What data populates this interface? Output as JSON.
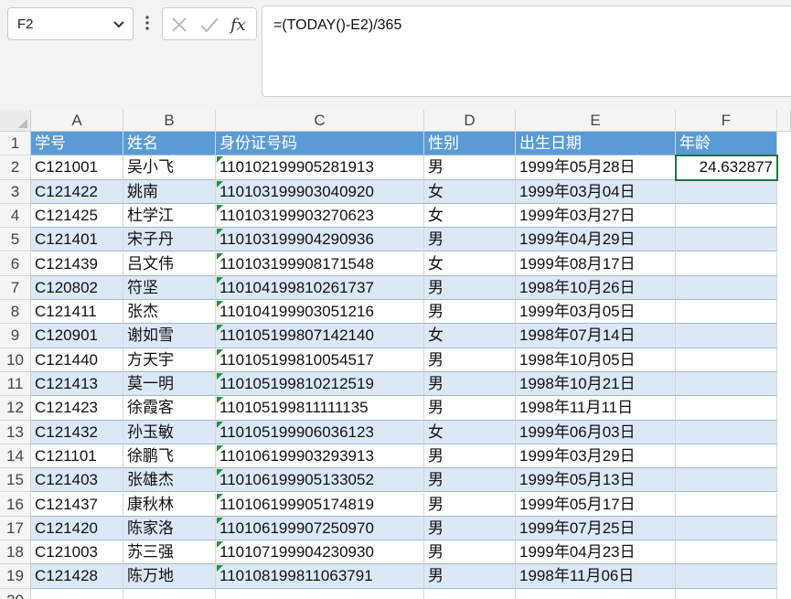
{
  "name_box": {
    "value": "F2"
  },
  "formula_bar": {
    "formula": "=(TODAY()-E2)/365"
  },
  "icons": {
    "dropdown": "chevron-down-icon",
    "more": "vertical-ellipsis-icon",
    "cancel": "cancel-x-icon",
    "enter": "checkmark-icon",
    "function": "fx-icon"
  },
  "colors": {
    "header_fill": "#5b9bd5",
    "band_fill": "#dde8f5",
    "error_flag": "#2e8b3a"
  },
  "column_headers": [
    "A",
    "B",
    "C",
    "D",
    "E",
    "F"
  ],
  "row_numbers": [
    "1",
    "2",
    "3",
    "4",
    "5",
    "6",
    "7",
    "8",
    "9",
    "10",
    "11",
    "12",
    "13",
    "14",
    "15",
    "16",
    "17",
    "18",
    "19",
    "20"
  ],
  "table": {
    "headers": [
      "学号",
      "姓名",
      "身份证号码",
      "性别",
      "出生日期",
      "年龄"
    ],
    "rows": [
      [
        "C121001",
        "吴小飞",
        "110102199905281913",
        "男",
        "1999年05月28日",
        "24.632877"
      ],
      [
        "C121422",
        "姚南",
        "110103199903040920",
        "女",
        "1999年03月04日",
        ""
      ],
      [
        "C121425",
        "杜学江",
        "110103199903270623",
        "女",
        "1999年03月27日",
        ""
      ],
      [
        "C121401",
        "宋子丹",
        "110103199904290936",
        "男",
        "1999年04月29日",
        ""
      ],
      [
        "C121439",
        "吕文伟",
        "110103199908171548",
        "女",
        "1999年08月17日",
        ""
      ],
      [
        "C120802",
        "符坚",
        "110104199810261737",
        "男",
        "1998年10月26日",
        ""
      ],
      [
        "C121411",
        "张杰",
        "110104199903051216",
        "男",
        "1999年03月05日",
        ""
      ],
      [
        "C120901",
        "谢如雪",
        "110105199807142140",
        "女",
        "1998年07月14日",
        ""
      ],
      [
        "C121440",
        "方天宇",
        "110105199810054517",
        "男",
        "1998年10月05日",
        ""
      ],
      [
        "C121413",
        "莫一明",
        "110105199810212519",
        "男",
        "1998年10月21日",
        ""
      ],
      [
        "C121423",
        "徐霞客",
        "110105199811111135",
        "男",
        "1998年11月11日",
        ""
      ],
      [
        "C121432",
        "孙玉敏",
        "110105199906036123",
        "女",
        "1999年06月03日",
        ""
      ],
      [
        "C121101",
        "徐鹏飞",
        "110106199903293913",
        "男",
        "1999年03月29日",
        ""
      ],
      [
        "C121403",
        "张雄杰",
        "110106199905133052",
        "男",
        "1999年05月13日",
        ""
      ],
      [
        "C121437",
        "康秋林",
        "110106199905174819",
        "男",
        "1999年05月17日",
        ""
      ],
      [
        "C121420",
        "陈家洛",
        "110106199907250970",
        "男",
        "1999年07月25日",
        ""
      ],
      [
        "C121003",
        "苏三强",
        "110107199904230930",
        "男",
        "1999年04月23日",
        ""
      ],
      [
        "C121428",
        "陈万地",
        "110108199811063791",
        "男",
        "1998年11月06日",
        ""
      ]
    ]
  }
}
